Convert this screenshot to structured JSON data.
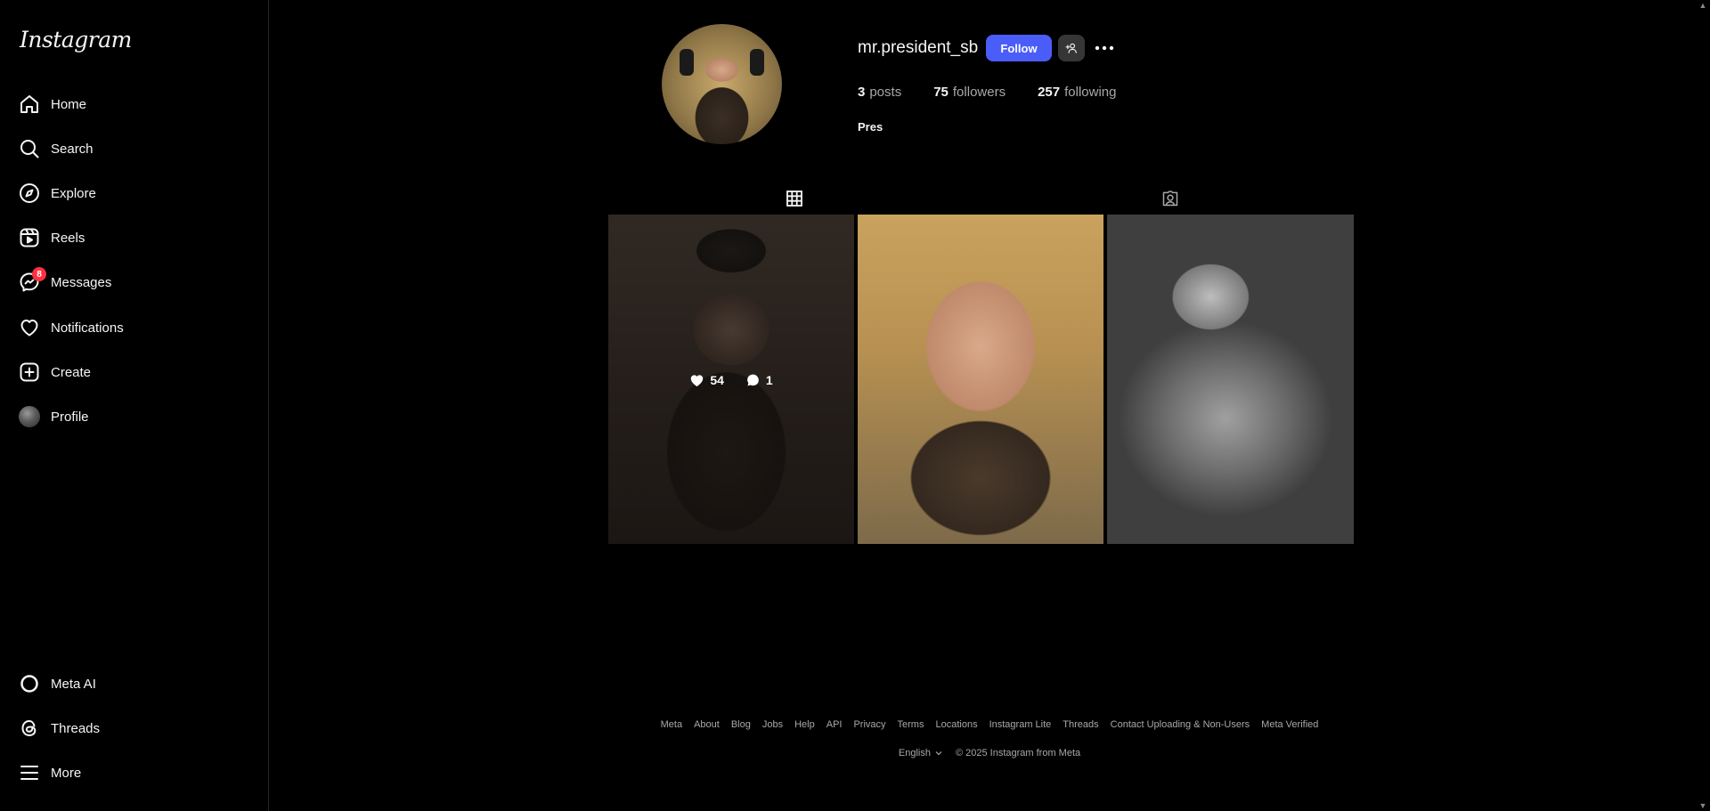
{
  "brand": {
    "logo": "Instagram"
  },
  "nav": {
    "home": "Home",
    "search": "Search",
    "explore": "Explore",
    "reels": "Reels",
    "messages": "Messages",
    "messages_badge": "8",
    "notifications": "Notifications",
    "create": "Create",
    "profile": "Profile",
    "meta_ai": "Meta AI",
    "threads": "Threads",
    "more": "More"
  },
  "profile": {
    "username": "mr.president_sb",
    "follow_label": "Follow",
    "posts_count": "3",
    "posts_label": "posts",
    "followers_count": "75",
    "followers_label": "followers",
    "following_count": "257",
    "following_label": "following",
    "bio_name": "Pres"
  },
  "tabs": [
    {
      "icon": "grid-icon",
      "active": true
    },
    {
      "icon": "tagged-icon",
      "active": false
    }
  ],
  "posts": [
    {
      "likes": "54",
      "comments": "1",
      "hovered": true
    },
    {
      "likes": "",
      "comments": ""
    },
    {
      "likes": "",
      "comments": ""
    }
  ],
  "footer": {
    "links": [
      "Meta",
      "About",
      "Blog",
      "Jobs",
      "Help",
      "API",
      "Privacy",
      "Terms",
      "Locations",
      "Instagram Lite",
      "Threads",
      "Contact Uploading & Non-Users",
      "Meta Verified"
    ],
    "language": "English",
    "copyright": "© 2025 Instagram from Meta"
  },
  "colors": {
    "background": "#000000",
    "follow_button": "#4a5df9",
    "badge": "#ff3040",
    "muted_text": "#a8a8a8"
  }
}
